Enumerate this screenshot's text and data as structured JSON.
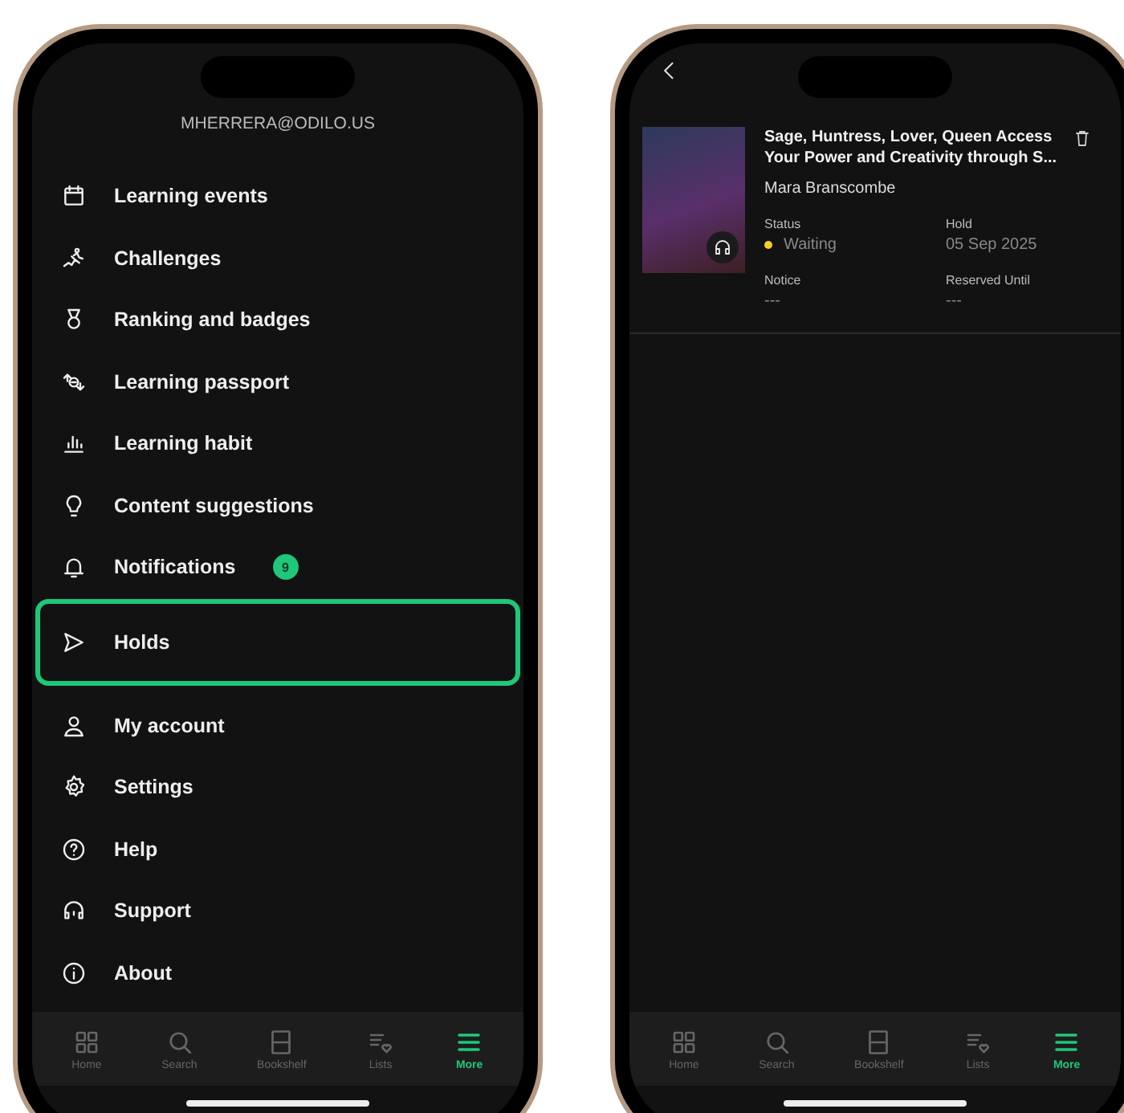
{
  "phones": [
    {
      "kind": "menu",
      "account_email": "MHERRERA@ODILO.US",
      "menu": [
        {
          "label": "Learning events",
          "selected": false
        },
        {
          "label": "Challenges",
          "selected": false
        },
        {
          "label": "Ranking and badges",
          "selected": false
        },
        {
          "label": "Learning passport",
          "selected": false
        },
        {
          "label": "Learning habit",
          "selected": false
        },
        {
          "label": "Content suggestions",
          "selected": false
        },
        {
          "label": "Notifications",
          "selected": false,
          "badge": "9"
        },
        {
          "label": "Holds",
          "selected": true
        },
        {
          "label": "My account",
          "selected": false
        },
        {
          "label": "Settings",
          "selected": false
        },
        {
          "label": "Help",
          "selected": false
        },
        {
          "label": "Support",
          "selected": false
        },
        {
          "label": "About",
          "selected": false
        }
      ],
      "tab_bar": [
        {
          "label": "Home",
          "selected": false
        },
        {
          "label": "Search",
          "selected": false
        },
        {
          "label": "Bookshelf",
          "selected": false
        },
        {
          "label": "Lists",
          "selected": false
        },
        {
          "label": "More",
          "selected": true
        }
      ]
    },
    {
      "kind": "holds",
      "holds": [
        {
          "title": "Sage, Huntress, Lover, Queen Access Your Power and Creativity through S...",
          "author": "Mara Branscombe",
          "details": [
            {
              "label": "Status",
              "value": "Waiting",
              "color": "#f2d024"
            },
            {
              "label": "Hold",
              "value": "05 Sep 2025"
            },
            {
              "label": "Notice",
              "value": "---"
            },
            {
              "label": "Reserved Until",
              "value": "---"
            }
          ]
        }
      ],
      "tab_bar": [
        {
          "label": "Home",
          "selected": false
        },
        {
          "label": "Search",
          "selected": false
        },
        {
          "label": "Bookshelf",
          "selected": false
        },
        {
          "label": "Lists",
          "selected": false
        },
        {
          "label": "More",
          "selected": true
        }
      ]
    }
  ]
}
